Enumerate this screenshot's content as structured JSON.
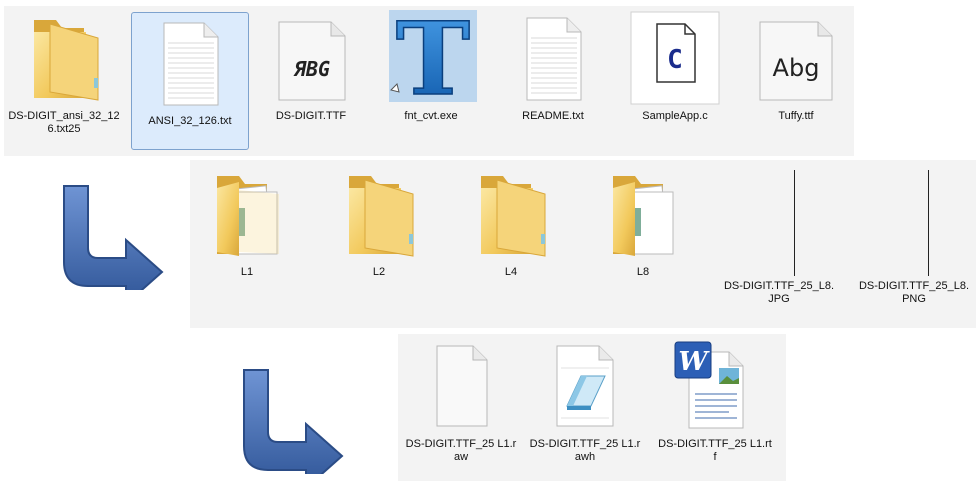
{
  "rows": {
    "top": [
      {
        "name": "DS-DIGIT_ansi_32_126.txt25",
        "icon": "folder-icon"
      },
      {
        "name": "ANSI_32_126.txt",
        "icon": "text-file-icon"
      },
      {
        "name": "DS-DIGIT.TTF",
        "icon": "font-file-icon",
        "preview": "ЯBG"
      },
      {
        "name": "fnt_cvt.exe",
        "icon": "app-t-icon",
        "glyph": "T"
      },
      {
        "name": "README.txt",
        "icon": "text-file-icon"
      },
      {
        "name": "SampleApp.c",
        "icon": "c-file-icon",
        "glyph": "C"
      },
      {
        "name": "Tuffy.ttf",
        "icon": "font-file-icon",
        "preview": "Abg"
      }
    ],
    "middle": [
      {
        "name": "L1",
        "icon": "folder-with-files-icon"
      },
      {
        "name": "L2",
        "icon": "folder-icon"
      },
      {
        "name": "L4",
        "icon": "folder-icon"
      },
      {
        "name": "L8",
        "icon": "folder-with-files-icon"
      },
      {
        "name": "DS-DIGIT.TTF_25_L8.JPG",
        "icon": "image-file-icon"
      },
      {
        "name": "DS-DIGIT.TTF_25_L8.PNG",
        "icon": "image-file-icon"
      }
    ],
    "bottom": [
      {
        "name": "DS-DIGIT.TTF_25 L1.raw",
        "icon": "blank-file-icon"
      },
      {
        "name": "DS-DIGIT.TTF_25 L1.rawh",
        "icon": "notepad-file-icon"
      },
      {
        "name": "DS-DIGIT.TTF_25 L1.rtf",
        "icon": "word-rtf-file-icon",
        "glyph": "W"
      }
    ]
  },
  "colors": {
    "folder": "#f2c95c",
    "folder_dark": "#d9a73a",
    "arrow": "#4a72b8",
    "selection": "#dcebfc"
  }
}
